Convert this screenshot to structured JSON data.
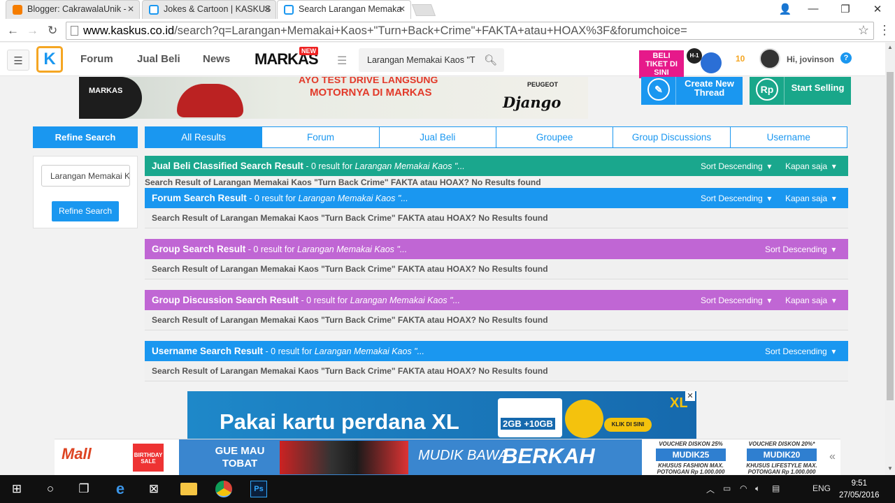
{
  "browser": {
    "tabs": [
      {
        "title": "Blogger: CakrawalaUnik - ·",
        "favicon": "blogger-icon"
      },
      {
        "title": "Jokes & Cartoon | KASKUS",
        "favicon": "kaskus-icon"
      },
      {
        "title": "Search Larangan Memaka",
        "favicon": "kaskus-icon"
      }
    ],
    "url_domain": "www.kaskus.co.id",
    "url_path": "/search?q=Larangan+Memakai+Kaos+\"Turn+Back+Crime\"+FAKTA+atau+HOAX%3F&forumchoice="
  },
  "header": {
    "nav": [
      "Forum",
      "Jual Beli",
      "News"
    ],
    "markas_label": "MARKAS",
    "new_badge": "NEW",
    "search_value": "Larangan Memakai Kaos \"T",
    "promo_text": "BELI TIKET DI SINI",
    "promo_badge": "H-1",
    "notif_count": "10",
    "greeting": "Hi, jovinson",
    "help": "?"
  },
  "banner": {
    "brand": "MARKAS",
    "line1": "AYO TEST DRIVE LANGSUNG",
    "line2": "MOTORNYA DI MARKAS",
    "peugeot": "PEUGEOT",
    "product": "Django"
  },
  "actions": {
    "create_thread": "Create New Thread",
    "start_selling": "Start Selling",
    "rp": "Rp"
  },
  "sidebar": {
    "title": "Refine Search",
    "input_value": "Larangan Memakai Kaos",
    "button": "Refine Search"
  },
  "tabs": [
    "All Results",
    "Forum",
    "Jual Beli",
    "Groupee",
    "Group Discussions",
    "Username"
  ],
  "results": [
    {
      "title": "Jual Beli Classified Search Result",
      "count_text": " - 0 result for ",
      "query": "Larangan Memakai Kaos \"...",
      "sort": "Sort Descending",
      "time": "Kapan saja",
      "message": "Search Result of Larangan Memakai Kaos \"Turn Back Crime\" FAKTA atau HOAX? No Results found"
    },
    {
      "title": "Forum Search Result",
      "count_text": " - 0 result for ",
      "query": "Larangan Memakai Kaos \"...",
      "sort": "Sort Descending",
      "time": "Kapan saja",
      "message": "Search Result of Larangan Memakai Kaos \"Turn Back Crime\" FAKTA atau HOAX? No Results found"
    },
    {
      "title": "Group Search Result",
      "count_text": " - 0 result for ",
      "query": "Larangan Memakai Kaos \"...",
      "sort": "Sort Descending",
      "message": "Search Result of Larangan Memakai Kaos \"Turn Back Crime\" FAKTA atau HOAX? No Results found"
    },
    {
      "title": "Group Discussion Search Result",
      "count_text": " - 0 result for ",
      "query": "Larangan Memakai Kaos \"...",
      "sort": "Sort Descending",
      "time": "Kapan saja",
      "message": "Search Result of Larangan Memakai Kaos \"Turn Back Crime\" FAKTA atau HOAX? No Results found"
    },
    {
      "title": "Username Search Result",
      "count_text": " - 0 result for ",
      "query": "Larangan Memakai Kaos \"...",
      "sort": "Sort Descending",
      "message": "Search Result of Larangan Memakai Kaos \"Turn Back Crime\" FAKTA atau HOAX? No Results found"
    }
  ],
  "ads": {
    "xl_text": "Pakai kartu perdana XL",
    "xl_card": "2GB +10GB",
    "xl_click": "KLIK DI SINI",
    "xl_brand": "XL",
    "mall": "Mall",
    "mall_badge": "BIRTHDAY SALE",
    "gue_mau_tobat": "GUE MAU TOBAT",
    "mudik_bawa": "MUDIK BAWA",
    "berkah": "BERKAH",
    "voucher1_title": "VOUCHER DISKON 25%",
    "voucher1_code": "MUDIK25",
    "voucher1_note": "KHUSUS FASHION MAX. POTONGAN Rp 1.000.000",
    "voucher2_title": "VOUCHER DISKON 20%*",
    "voucher2_code": "MUDIK20",
    "voucher2_note": "KHUSUS LIFESTYLE MAX. POTONGAN Rp 1.000.000"
  },
  "taskbar": {
    "lang": "ENG",
    "time": "9:51",
    "date": "27/05/2016"
  },
  "colors": {
    "kaskus_blue": "#1a97f0",
    "teal": "#1aa78d",
    "purple": "#c066d4"
  }
}
